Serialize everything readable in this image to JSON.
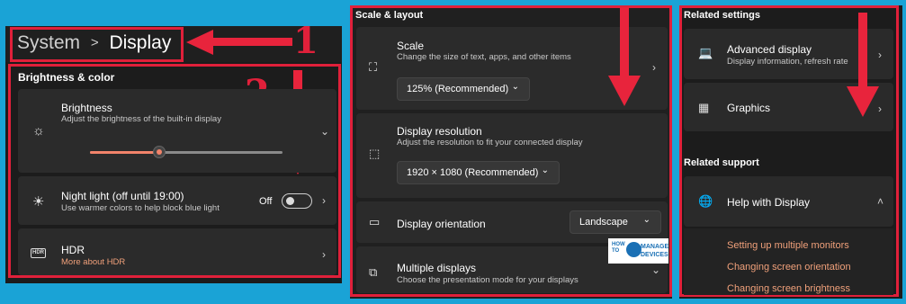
{
  "left": {
    "breadcrumb_root": "System",
    "breadcrumb_sep": ">",
    "breadcrumb_current": "Display",
    "section": "Brightness & color",
    "brightness": {
      "title": "Brightness",
      "sub": "Adjust the brightness of the built-in display",
      "level": 0.35
    },
    "night": {
      "title": "Night light (off until 19:00)",
      "sub": "Use warmer colors to help block blue light",
      "state": "Off"
    },
    "hdr": {
      "title": "HDR",
      "link": "More about HDR",
      "badge": "HDR"
    },
    "callout1": "1",
    "callout2": "2"
  },
  "middle": {
    "section": "Scale & layout",
    "scale": {
      "title": "Scale",
      "sub": "Change the size of text, apps, and other items",
      "value": "125% (Recommended)"
    },
    "resolution": {
      "title": "Display resolution",
      "sub": "Adjust the resolution to fit your connected display",
      "value": "1920 × 1080 (Recommended)"
    },
    "orientation": {
      "title": "Display orientation",
      "value": "Landscape"
    },
    "multiple": {
      "title": "Multiple displays",
      "sub": "Choose the presentation mode for your displays"
    },
    "watermark": {
      "how": "HOW",
      "to": "TO",
      "manage": "MANAGE",
      "devices": "DEVICES"
    }
  },
  "right": {
    "section1": "Related settings",
    "advanced": {
      "title": "Advanced display",
      "sub": "Display information, refresh rate"
    },
    "graphics": {
      "title": "Graphics"
    },
    "section2": "Related support",
    "help": {
      "title": "Help with Display"
    },
    "links": [
      "Setting up multiple monitors",
      "Changing screen orientation",
      "Changing screen brightness"
    ]
  },
  "colors": {
    "accent_red": "#e0203a",
    "background": "#1aa3d6",
    "link": "#f0a07a"
  }
}
